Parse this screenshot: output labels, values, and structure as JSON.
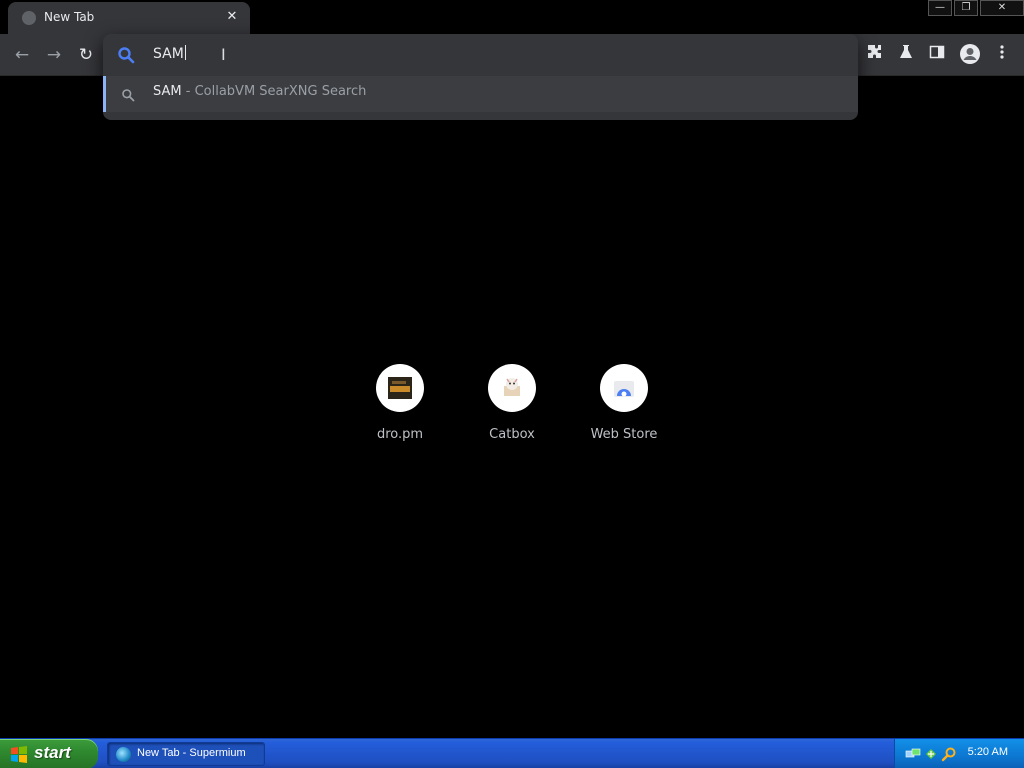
{
  "browser": {
    "tab": {
      "title": "New Tab",
      "close_glyph": "✕"
    },
    "window_controls": {
      "minimize": "—",
      "restore": "❐",
      "close": "✕"
    },
    "nav": {
      "back": "←",
      "forward": "→",
      "reload": "↻"
    },
    "omnibox": {
      "typed_text": "SAM",
      "suggestion": {
        "query": "SAM",
        "separator": " - ",
        "engine": "CollabVM SearXNG Search"
      }
    },
    "toolbar_icons": [
      "extensions-icon",
      "labs-flask-icon",
      "side-panel-icon",
      "profile-icon",
      "menu-icon"
    ]
  },
  "new_tab_page": {
    "shortcuts": [
      {
        "label": "dro.pm",
        "icon": "dropm-icon"
      },
      {
        "label": "Catbox",
        "icon": "catbox-icon"
      },
      {
        "label": "Web Store",
        "icon": "webstore-icon"
      }
    ]
  },
  "taskbar": {
    "start_label": "start",
    "task_item_label": "New Tab - Supermium",
    "clock": "5:20 AM"
  },
  "colors": {
    "page_bg": "#000000",
    "chrome_bg": "#35363a",
    "accent": "#8ab4f8",
    "search_icon_blue": "#4c7ef3"
  }
}
